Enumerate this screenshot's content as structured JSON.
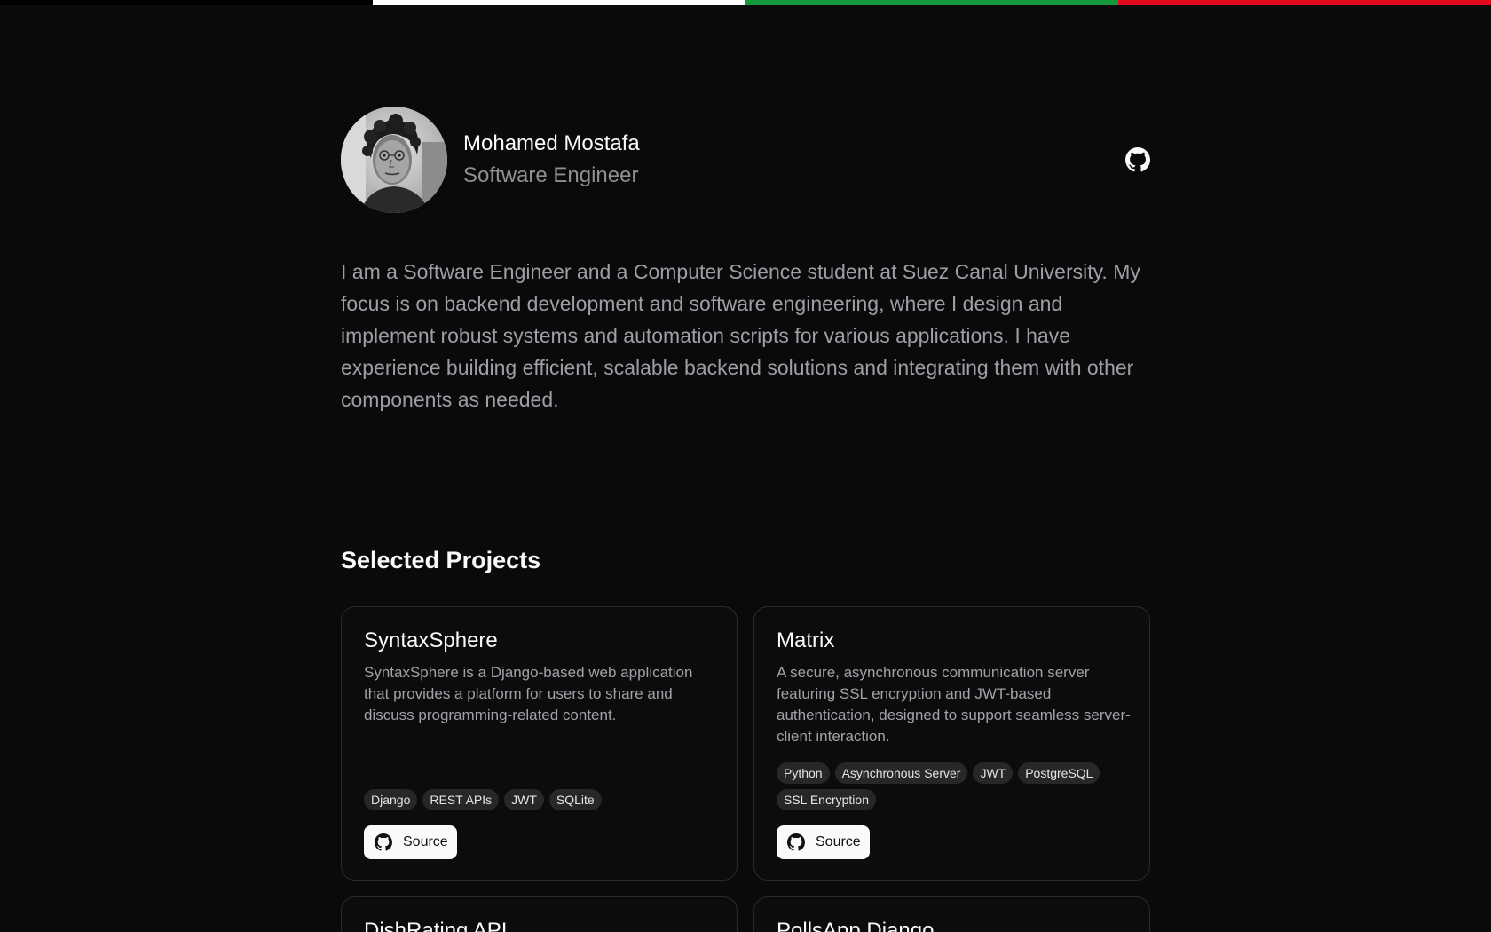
{
  "flag_colors": [
    "#000000",
    "#ffffff",
    "#149a3c",
    "#e2091c"
  ],
  "profile": {
    "name": "Mohamed Mostafa",
    "role": "Software Engineer",
    "avatar_icon": "portrait-photo",
    "github_icon": "github-icon"
  },
  "bio": "I am a Software Engineer and a Computer Science student at Suez Canal University. My focus is on backend development and software engineering, where I design and implement robust systems and automation scripts for various applications. I have experience building efficient, scalable backend solutions and integrating them with other components as needed.",
  "projects_section": {
    "title": "Selected Projects",
    "projects": [
      {
        "title": "SyntaxSphere",
        "description": "SyntaxSphere is a Django-based web application that provides a platform for users to share and discuss programming-related content.",
        "tags": [
          "Django",
          "REST APIs",
          "JWT",
          "SQLite"
        ],
        "button_label": "Source"
      },
      {
        "title": "Matrix",
        "description": "A secure, asynchronous communication server featuring SSL encryption and JWT-based authentication, designed to support seamless server-client interaction.",
        "tags": [
          "Python",
          "Asynchronous Server",
          "JWT",
          "PostgreSQL",
          "SSL Encryption"
        ],
        "button_label": "Source"
      },
      {
        "title": "DishRating API"
      },
      {
        "title": "PollsApp Django"
      }
    ]
  }
}
